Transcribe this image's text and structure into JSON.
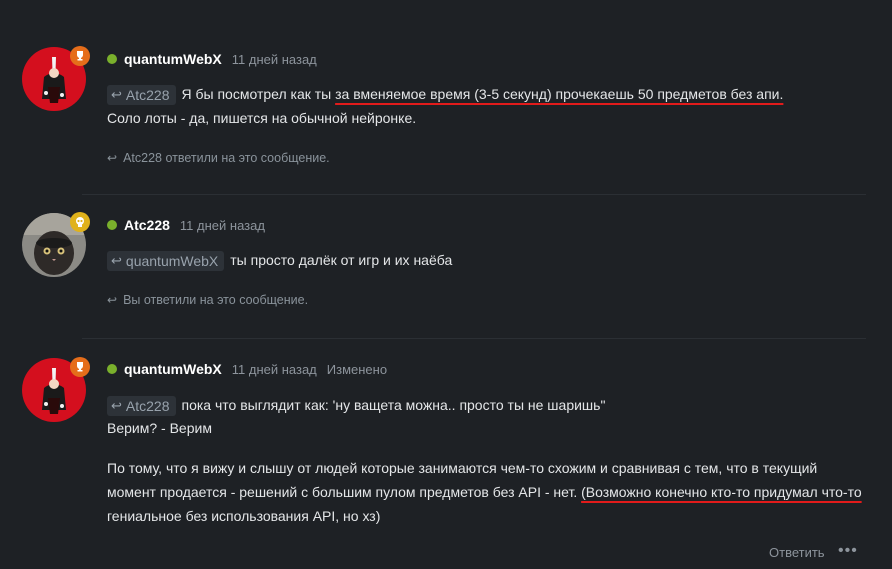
{
  "posts": [
    {
      "author": "quantumWebX",
      "time": "11 дней назад",
      "quote_user": "Atc228",
      "text_before": "Я бы посмотрел как ты ",
      "text_underlined": "за вменяемое время (3-5 секунд) прочекаешь 50 предметов без апи.",
      "line2": "Соло лоты - да, пишется на обычной нейронке.",
      "reply_note": "Atc228 ответили на это сообщение."
    },
    {
      "author": "Atc228",
      "time": "11 дней назад",
      "quote_user": "quantumWebX",
      "text": "ты просто далёк от игр и их наёба",
      "reply_note": "Вы ответили на это сообщение."
    },
    {
      "author": "quantumWebX",
      "time": "11 дней назад",
      "edited": "Изменено",
      "quote_user": "Atc228",
      "text": "пока что выглядит как: 'ну ващета можна.. просто ты не шаришь\"",
      "line2": "Верим? - Верим",
      "para_line1": "По тому, что я вижу и слышу от людей которые занимаются чем-то схожим и сравнивая с тем, что в текущий",
      "para_line2_before": "момент продается - решений с большим пулом предметов без API - нет. ",
      "para_line2_underlined": "(Возможно конечно кто-то придумал что-то",
      "para_line3": "гениальное без использования API, но хз)",
      "reply_label": "Ответить",
      "more_label": "•••"
    }
  ],
  "icons": {
    "reply": "↩",
    "trophy": "🏆",
    "skull": "☠"
  },
  "colors": {
    "background": "#1e2125",
    "online": "#7ab02c",
    "underline": "#e21b1b",
    "trophy_badge": "#e56d1a",
    "skull_badge": "#e0b21b"
  }
}
